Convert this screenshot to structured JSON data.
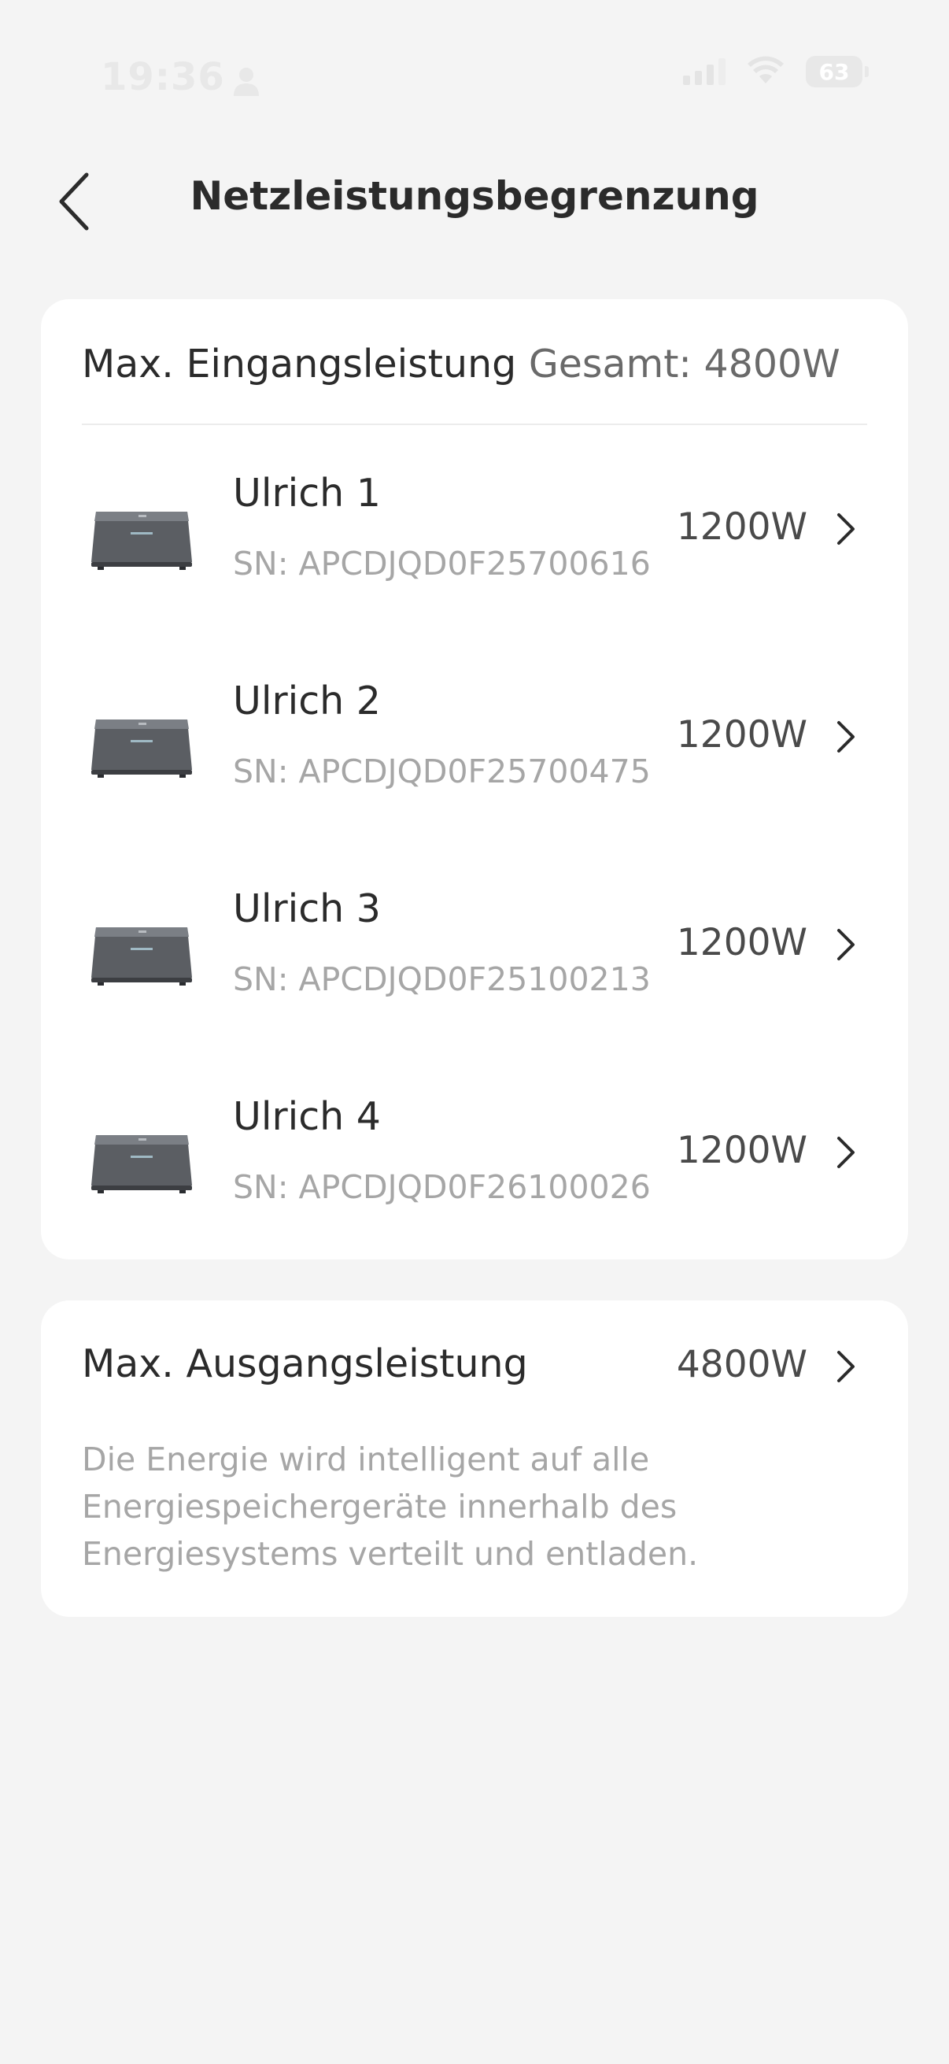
{
  "status_bar": {
    "time": "19:36",
    "battery": "63"
  },
  "header": {
    "title": "Netzleistungsbegrenzung"
  },
  "input_card": {
    "label": "Max. Eingangsleistung",
    "total": "Gesamt: 4800W",
    "devices": [
      {
        "name": "Ulrich 1",
        "sn": "SN: APCDJQD0F25700616",
        "power": "1200W"
      },
      {
        "name": "Ulrich 2",
        "sn": "SN: APCDJQD0F25700475",
        "power": "1200W"
      },
      {
        "name": "Ulrich 3",
        "sn": "SN: APCDJQD0F25100213",
        "power": "1200W"
      },
      {
        "name": "Ulrich 4",
        "sn": "SN: APCDJQD0F26100026",
        "power": "1200W"
      }
    ]
  },
  "output_card": {
    "label": "Max. Ausgangsleistung",
    "value": "4800W",
    "description": "Die Energie wird intelligent auf alle Energiespeichergeräte innerhalb des Energiesystems verteilt und entladen."
  }
}
